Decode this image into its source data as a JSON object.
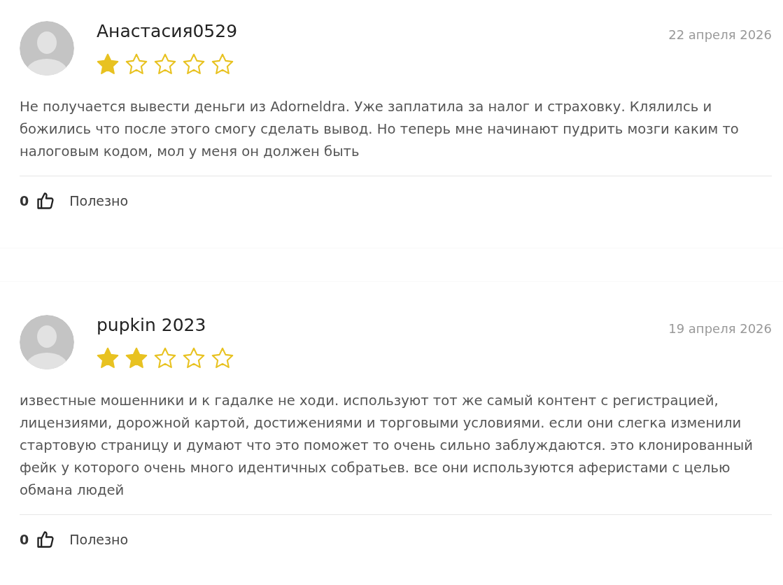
{
  "reviews": [
    {
      "author": "Анастасия0529",
      "date": "22 апреля 2026",
      "stars": 1,
      "text": "Не получается вывести деньги из Adorneldra. Уже заплатила за налог и страховку. Клялилсь и божились что после этого смогу сделать вывод. Но теперь мне начинают пудрить мозги каким то налоговым кодом, мол у меня он должен быть",
      "likes": "0",
      "helpful_label": "Полезно"
    },
    {
      "author": "pupkin 2023",
      "date": "19 апреля 2026",
      "stars": 2,
      "text": "известные мошенники и к гадалке не ходи. используют тот же самый контент с регистрацией, лицензиями, дорожной картой, достижениями и торговыми условиями. если они слегка изменили стартовую страницу и думают что это поможет то очень сильно заблуждаются. это клонированный фейк у которого очень много идентичных собратьев. все они используются аферистами с целью обмана людей",
      "likes": "0",
      "helpful_label": "Полезно"
    }
  ]
}
